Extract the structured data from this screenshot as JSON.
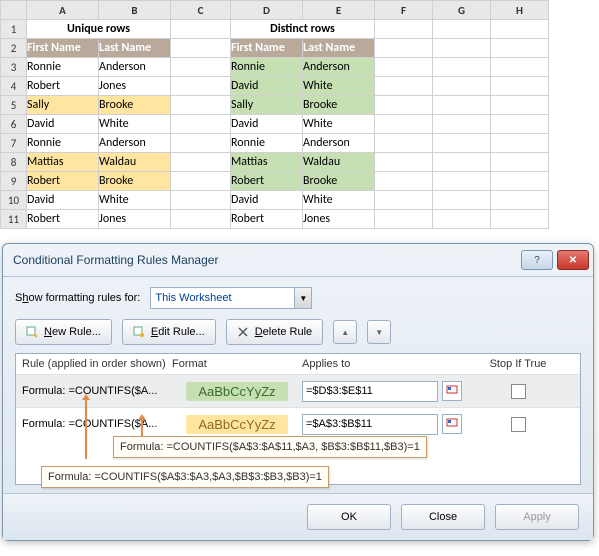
{
  "columns": [
    "A",
    "B",
    "C",
    "D",
    "E",
    "F",
    "G",
    "H"
  ],
  "rows": [
    "1",
    "2",
    "3",
    "4",
    "5",
    "6",
    "7",
    "8",
    "9",
    "10",
    "11"
  ],
  "headers": {
    "unique": "Unique rows",
    "distinct": "Distinct rows"
  },
  "th": {
    "first": "First Name",
    "last": "Last Name",
    "firstD": "First Name",
    "lastD": "Last Name"
  },
  "d": {
    "a3": "Ronnie",
    "b3": "Anderson",
    "d3": "Ronnie",
    "e3": "Anderson",
    "a4": "Robert",
    "b4": "Jones",
    "d4": "David",
    "e4": "White",
    "a5": "Sally",
    "b5": "Brooke",
    "d5": "Sally",
    "e5": "Brooke",
    "a6": "David",
    "b6": "White",
    "d6": "David",
    "e6": "White",
    "a7": "Ronnie",
    "b7": "Anderson",
    "d7": "Ronnie",
    "e7": "Anderson",
    "a8": "Mattias",
    "b8": "Waldau",
    "d8": "Mattias",
    "e8": "Waldau",
    "a9": "Robert",
    "b9": "Brooke",
    "d9": "Robert",
    "e9": "Brooke",
    "a10": "David",
    "b10": "White",
    "d10": "David",
    "e10": "White",
    "a11": "Robert",
    "b11": "Jones",
    "d11": "Robert",
    "e11": "Jones"
  },
  "dialog": {
    "title": "Conditional Formatting Rules Manager",
    "scope_label_pre": "S",
    "scope_label_u": "h",
    "scope_label_post": "ow formatting rules for:",
    "scope": "This Worksheet",
    "btn_new_u": "N",
    "btn_new": "ew Rule...",
    "btn_edit_u": "E",
    "btn_edit": "dit Rule...",
    "btn_del_u": "D",
    "btn_del": "elete Rule",
    "hdr_rule": "Rule (applied in order shown)",
    "hdr_format": "Format",
    "hdr_applies": "Applies to",
    "hdr_stop": "Stop If True",
    "r1_name": "Formula: =COUNTIFS($A...",
    "r1_fmt": "AaBbCcYyZz",
    "r1_ref": "=$D$3:$E$11",
    "r2_name": "Formula: =COUNTIFS($A...",
    "r2_fmt": "AaBbCcYyZz",
    "r2_ref": "=$A$3:$B$11",
    "callout1": "Formula: =COUNTIFS($A$3:$A$11,$A3, $B$3:$B$11,$B3)=1",
    "callout2": "Formula: =COUNTIFS($A$3:$A3,$A3,$B$3:$B3,$B3)=1",
    "ok": "OK",
    "close": "Close",
    "apply": "Apply",
    "help": "?",
    "closex": "✕",
    "up": "▲",
    "down": "▼"
  }
}
